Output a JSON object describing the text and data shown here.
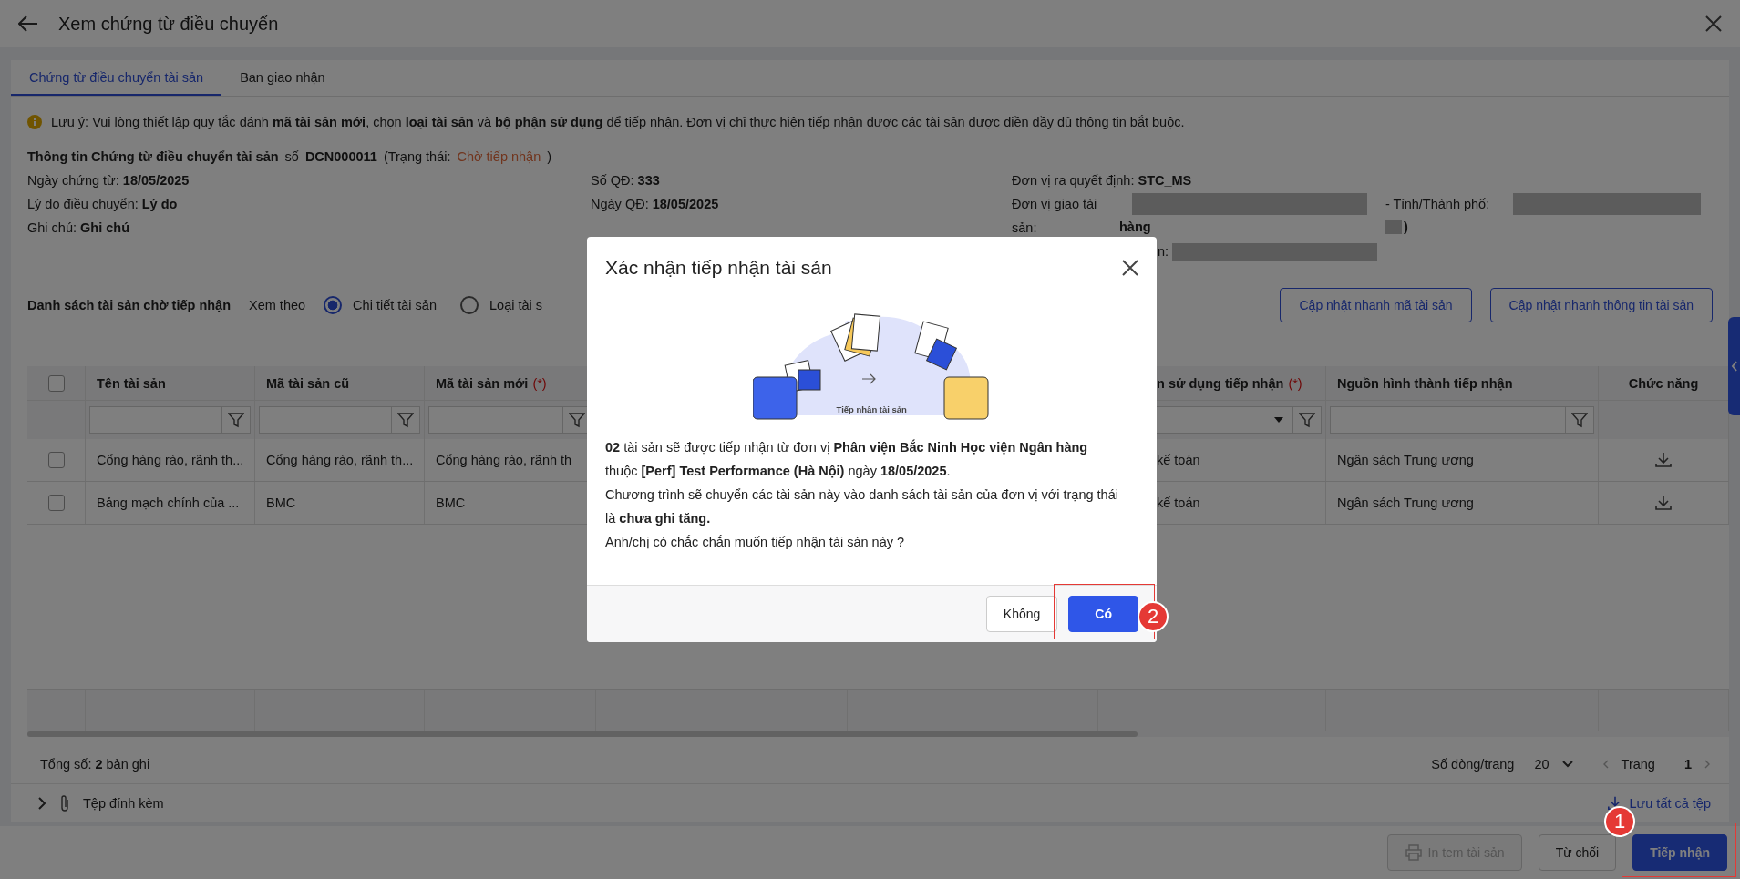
{
  "header": {
    "title": "Xem chứng từ điều chuyển"
  },
  "tabs": [
    {
      "label": "Chứng từ điều chuyển tài sản",
      "selected": true
    },
    {
      "label": "Ban giao nhận",
      "selected": false
    }
  ],
  "notice": "Lưu ý: Vui lòng thiết lập quy tắc đánh **mã tài sản mới**, chọn **loại tài sản** và **bộ phận sử dụng** để tiếp nhận. Đơn vị chỉ thực hiện tiếp nhận được các tài sản được điền đầy đủ thông tin bắt buộc.",
  "document": {
    "title": "Thông tin Chứng từ điều chuyển tài sản",
    "number_label": "số",
    "number": "DCN000011",
    "status_label": "(Trạng thái:",
    "status": "Chờ tiếp nhận",
    "status_end": ")"
  },
  "details_left": [
    {
      "label": "Ngày chứng từ:",
      "value": "18/05/2025"
    },
    {
      "label": "Lý do điều chuyển:",
      "value": "Lý do"
    },
    {
      "label": "Ghi chú:",
      "value": "Ghi chú"
    }
  ],
  "details_middle": [
    {
      "label": "Số QĐ:",
      "value": "333"
    },
    {
      "label": "Ngày QĐ:",
      "value": "18/05/2025"
    }
  ],
  "details_right": [
    {
      "kind": "plain",
      "label": "Đơn vị ra quyết định:",
      "value": "STC_MS"
    },
    {
      "kind": "redacted",
      "label": "Đơn vị giao tài sản:",
      "value": "hàng",
      "extra_label": "- Tỉnh/Thành phố:",
      "extra_value": ")"
    },
    {
      "kind": "cut",
      "label": "n:"
    }
  ],
  "list": {
    "title": "Danh sách tài sản chờ tiếp nhận",
    "view_label": "Xem theo",
    "view_options": [
      {
        "label": "Chi tiết tài sản",
        "selected": true
      },
      {
        "label": "Loại tài s",
        "selected": false
      }
    ],
    "actions": [
      "Cập nhật nhanh mã tài sản",
      "Cập nhật nhanh thông tin tài sản"
    ]
  },
  "table": {
    "all_checked": false,
    "columns": [
      {
        "kind": "text",
        "label": "Tên tài sản",
        "filter": true,
        "dropdown": false
      },
      {
        "kind": "text",
        "label": "Mã tài sản cũ",
        "filter": true,
        "dropdown": false
      },
      {
        "kind": "text",
        "label": "Mã tài sản mới",
        "required_mark": "(*)",
        "filter": true,
        "dropdown": false
      },
      {
        "kind": "cut",
        "label": "n sử dụng tiếp nhận",
        "required_mark": "(*)",
        "filter": true,
        "dropdown": true
      },
      {
        "kind": "text",
        "label": "Nguồn hình thành tiếp nhận",
        "filter": true,
        "dropdown": false
      },
      {
        "kind": "action",
        "label": "Chức năng",
        "filter": false
      }
    ],
    "rows": [
      {
        "checked": false,
        "cells": [
          "Cổng hàng rào, rãnh th...",
          "Cổng hàng rào, rãnh th...",
          "Cổng hàng rào, rãnh th",
          "kế toán",
          "Ngân sách Trung ương"
        ]
      },
      {
        "checked": false,
        "cells": [
          "Bảng mạch chính của ...",
          "BMC",
          "BMC",
          "kế toán",
          "Ngân sách Trung ương"
        ]
      }
    ]
  },
  "pager": {
    "total": "Tổng số: **2** bản ghi",
    "page_size_label": "Số dòng/trang",
    "page_size": "20",
    "page_label": "Trang",
    "page": "1"
  },
  "attachments": {
    "label": "Tệp đính kèm",
    "save_all": "Lưu tất cả tệp"
  },
  "footer_buttons": [
    {
      "label": "In tem tài sản",
      "kind": "print",
      "disabled": true
    },
    {
      "label": "Từ chối",
      "kind": "secondary",
      "disabled": false
    },
    {
      "label": "Tiếp nhận",
      "kind": "primary",
      "disabled": false,
      "callout": "1"
    }
  ],
  "modal": {
    "title": "Xác nhận tiếp nhận tài sản",
    "illustration_label": "Tiếp nhận tài sản",
    "paragraphs": [
      "**02** tài sản sẽ được tiếp nhận từ đơn vị **Phân viện Bắc Ninh Học viện Ngân hàng** thuộc **[Perf] Test Performance (Hà Nội)** ngày **18/05/2025**.",
      "Chương trình sẽ chuyển các tài sản này vào danh sách tài sản của đơn vị với trạng thái là **chưa ghi tăng.**",
      "Anh/chị có chắc chắn muốn tiếp nhận tài sản này ?"
    ],
    "buttons": [
      {
        "label": "Không",
        "kind": "secondary"
      },
      {
        "label": "Có",
        "kind": "primary",
        "callout": "2"
      }
    ]
  }
}
